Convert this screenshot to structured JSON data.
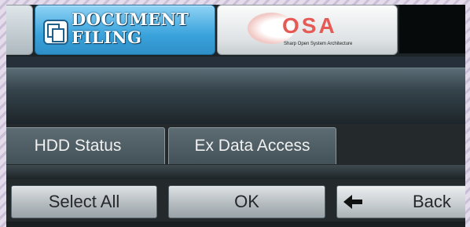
{
  "top_tabs": {
    "document_filing": {
      "label_line1": "DOCUMENT",
      "label_line2": "FILING",
      "icon": "document-filing-icon"
    },
    "osa": {
      "logo_text": "OSA",
      "tagline": "Sharp Open System Architecture",
      "icon": "osa-logo"
    }
  },
  "settings_tabs": [
    {
      "label": "HDD Status"
    },
    {
      "label": "Ex Data Access"
    }
  ],
  "buttons": {
    "select_all": "Select All",
    "ok": "OK",
    "back": "Back",
    "back_icon": "left-arrow-icon"
  },
  "colors": {
    "active_tab": "#3aa3dc",
    "osa_red": "#e65a55",
    "background": "#2b3438",
    "button": "#b5bcc0"
  }
}
